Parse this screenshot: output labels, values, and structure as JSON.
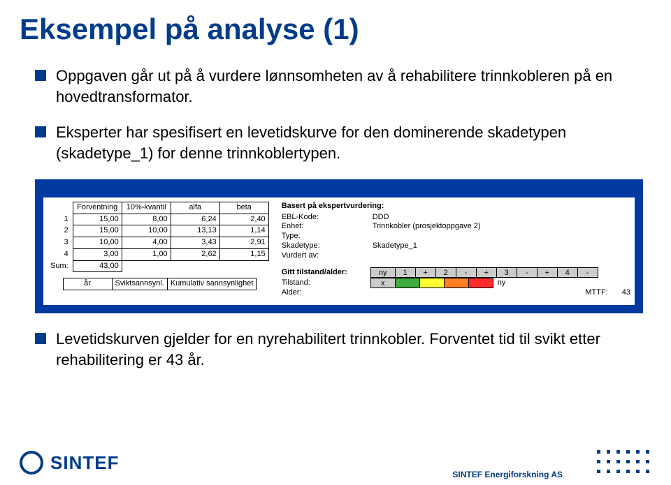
{
  "title": "Eksempel på analyse (1)",
  "bullets": [
    "Oppgaven går ut på å vurdere lønnsomheten av å rehabilitere trinnkobleren på en hovedtransformator.",
    "Eksperter har spesifisert en levetidskurve for den dominerende skadetypen (skadetype_1) for denne trinnkoblertypen."
  ],
  "left_table": {
    "headers": [
      "Forventning",
      "10%-kvantil",
      "alfa",
      "beta"
    ],
    "rowlabels": [
      "1",
      "2",
      "3",
      "4",
      "Sum:"
    ],
    "rows": [
      [
        "15,00",
        "8,00",
        "6,24",
        "2,40"
      ],
      [
        "15,00",
        "10,00",
        "13,13",
        "1,14"
      ],
      [
        "10,00",
        "4,00",
        "3,43",
        "2,91"
      ],
      [
        "3,00",
        "1,00",
        "2,62",
        "1,15"
      ],
      [
        "43,00",
        "",
        "",
        ""
      ]
    ],
    "bottom": {
      "col1": "år",
      "col2": "Sviktsannsynl.",
      "col3": "Kumulativ sannsynlighet"
    }
  },
  "right_block": {
    "heading": "Basert på ekspertvurdering:",
    "lines": [
      {
        "label": "EBL-Kode:",
        "value": "DDD"
      },
      {
        "label": "Enhet:",
        "value": "Trinnkobler (prosjektoppgave 2)"
      },
      {
        "label": "Type:",
        "value": ""
      },
      {
        "label": "Skadetype:",
        "value": "Skadetype_1"
      },
      {
        "label": "Vurdert av:",
        "value": ""
      }
    ],
    "gitt": {
      "label": "Gitt tilstand/alder:",
      "first": "ny",
      "cells": [
        "1",
        "+",
        "2",
        "-",
        "+",
        "3",
        "-",
        "+",
        "4",
        "-"
      ]
    },
    "tilstand_label": "Tilstand:",
    "tilstand_x": "x",
    "tilstand_ny": "ny",
    "alder": {
      "label": "Alder:",
      "mttf_label": "MTTF:",
      "mttf_value": "43"
    }
  },
  "bullet3": "Levetidskurven gjelder for en nyrehabilitert trinnkobler. Forventet tid til svikt etter rehabilitering er 43 år.",
  "footer": {
    "brand": "SINTEF",
    "department": "SINTEF Energiforskning AS"
  },
  "chart_data": {
    "type": "table",
    "title": "Levetidskurve – ekspertvurdering",
    "columns": [
      "Forventning",
      "10%-kvantil",
      "alfa",
      "beta"
    ],
    "rows": [
      {
        "i": 1,
        "Forventning": 15.0,
        "10%-kvantil": 8.0,
        "alfa": 6.24,
        "beta": 2.4
      },
      {
        "i": 2,
        "Forventning": 15.0,
        "10%-kvantil": 10.0,
        "alfa": 13.13,
        "beta": 1.14
      },
      {
        "i": 3,
        "Forventning": 10.0,
        "10%-kvantil": 4.0,
        "alfa": 3.43,
        "beta": 2.91
      },
      {
        "i": 4,
        "Forventning": 3.0,
        "10%-kvantil": 1.0,
        "alfa": 2.62,
        "beta": 1.15
      }
    ],
    "sum_forventning": 43.0,
    "mttf": 43
  }
}
